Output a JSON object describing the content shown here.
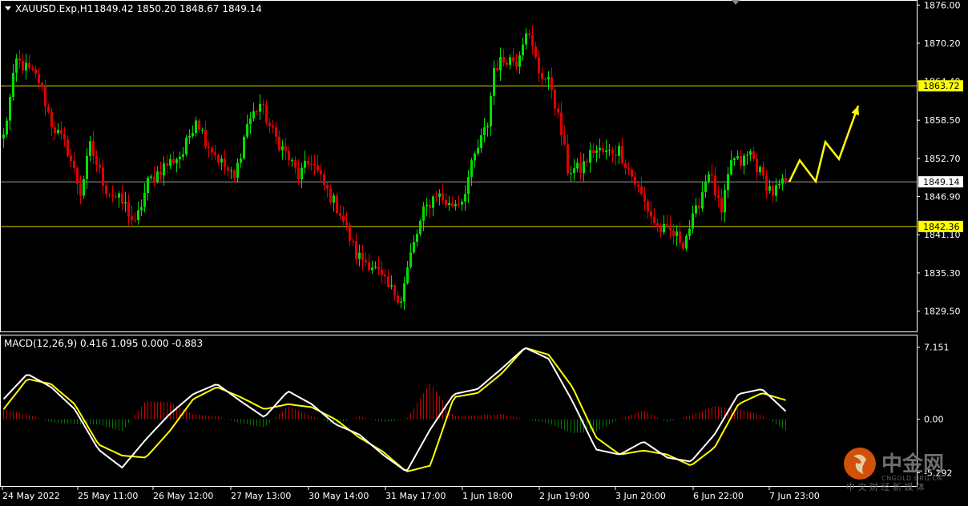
{
  "header": {
    "symbol_line": "XAUUSD.Exp,H1",
    "ohlc": "1849.42 1850.20 1848.67 1849.14",
    "macd_line": "MACD(12,26,9) 0.416 1.095 0.000 -0.883"
  },
  "watermark": {
    "logo_text": "中金网",
    "url_text": "CNGOLD.ORG.CN",
    "subtitle": "中 文 财 经 新 媒 体"
  },
  "chart_data": {
    "type": "candlestick",
    "symbol": "XAUUSD.Exp",
    "timeframe": "H1",
    "price_axis": {
      "min": 1827.5,
      "max": 1876.4,
      "ticks": [
        "1876.00",
        "1870.20",
        "1864.40",
        "1858.50",
        "1852.70",
        "1846.90",
        "1841.10",
        "1835.30",
        "1829.50"
      ]
    },
    "levels": [
      {
        "label": "1863.72",
        "value": 1863.72,
        "color": "#d8d800",
        "badge_bg": "#ffff00"
      },
      {
        "label": "1849.14",
        "value": 1849.14,
        "color": "#9a9a9a",
        "badge_bg": "#ffffff"
      },
      {
        "label": "1842.36",
        "value": 1842.36,
        "color": "#d8d800",
        "badge_bg": "#ffff00"
      }
    ],
    "time_labels": [
      "24 May 2022",
      "25 May 11:00",
      "26 May 12:00",
      "27 May 13:00",
      "30 May 14:00",
      "31 May 17:00",
      "1 Jun 18:00",
      "2 Jun 19:00",
      "3 Jun 20:00",
      "6 Jun 22:00",
      "7 Jun 23:00"
    ],
    "close_path": [
      [
        0,
        1856.0
      ],
      [
        4,
        1867.5
      ],
      [
        8,
        1866.0
      ],
      [
        11,
        1864.5
      ],
      [
        15,
        1858.0
      ],
      [
        20,
        1854.0
      ],
      [
        24,
        1847.5
      ],
      [
        27,
        1854.5
      ],
      [
        32,
        1848.0
      ],
      [
        38,
        1845.5
      ],
      [
        41,
        1842.5
      ],
      [
        45,
        1849.0
      ],
      [
        50,
        1851.5
      ],
      [
        56,
        1853.5
      ],
      [
        60,
        1859.0
      ],
      [
        63,
        1855.5
      ],
      [
        68,
        1852.0
      ],
      [
        72,
        1849.5
      ],
      [
        76,
        1858.0
      ],
      [
        80,
        1861.0
      ],
      [
        84,
        1856.5
      ],
      [
        88,
        1853.5
      ],
      [
        92,
        1850.0
      ],
      [
        96,
        1852.5
      ],
      [
        100,
        1848.5
      ],
      [
        105,
        1844.5
      ],
      [
        110,
        1838.0
      ],
      [
        115,
        1836.5
      ],
      [
        120,
        1833.0
      ],
      [
        124,
        1831.5
      ],
      [
        127,
        1838.0
      ],
      [
        131,
        1844.5
      ],
      [
        135,
        1847.5
      ],
      [
        139,
        1845.5
      ],
      [
        143,
        1846.5
      ],
      [
        147,
        1853.0
      ],
      [
        151,
        1858.0
      ],
      [
        153,
        1866.5
      ],
      [
        157,
        1868.0
      ],
      [
        160,
        1867.5
      ],
      [
        163,
        1872.5
      ],
      [
        167,
        1866.0
      ],
      [
        171,
        1863.5
      ],
      [
        174,
        1856.5
      ],
      [
        176,
        1851.0
      ],
      [
        180,
        1851.0
      ],
      [
        184,
        1854.0
      ],
      [
        188,
        1853.5
      ],
      [
        192,
        1854.0
      ],
      [
        196,
        1850.0
      ],
      [
        200,
        1846.0
      ],
      [
        204,
        1842.0
      ],
      [
        208,
        1841.5
      ],
      [
        212,
        1840.0
      ],
      [
        216,
        1844.5
      ],
      [
        220,
        1851.0
      ],
      [
        224,
        1844.0
      ],
      [
        227,
        1852.5
      ],
      [
        230,
        1852.0
      ],
      [
        233,
        1853.5
      ],
      [
        237,
        1849.5
      ],
      [
        240,
        1847.5
      ],
      [
        244,
        1849.14
      ]
    ],
    "projection": [
      1849.14,
      1852.4,
      1849.2,
      1855.2,
      1852.6,
      1860.7
    ],
    "macd": {
      "label": "MACD(12,26,9)",
      "values": [
        "0.416",
        "1.095",
        "0.000",
        "-0.883"
      ],
      "ticks": [
        "7.151",
        "0.00",
        "-5.292"
      ],
      "range": [
        -6.3,
        7.6
      ],
      "main_line": [
        2.0,
        4.5,
        3.2,
        1.0,
        -3.0,
        -4.8,
        -2.0,
        0.5,
        2.5,
        3.5,
        1.8,
        0.2,
        2.8,
        1.5,
        -0.5,
        -1.5,
        -3.5,
        -5.2,
        -1.0,
        2.5,
        3.0,
        5.0,
        7.1,
        6.0,
        1.8,
        -3.0,
        -3.5,
        -2.2,
        -3.8,
        -4.2,
        -1.5,
        2.5,
        3.0,
        0.8
      ],
      "signal_line": [
        1.0,
        4.0,
        3.5,
        1.5,
        -2.5,
        -3.6,
        -3.8,
        -1.2,
        2.0,
        3.2,
        2.2,
        1.0,
        1.5,
        1.2,
        0.0,
        -1.8,
        -3.2,
        -5.2,
        -4.6,
        2.2,
        2.6,
        4.5,
        7.1,
        6.4,
        3.2,
        -1.8,
        -3.5,
        -3.1,
        -3.5,
        -4.6,
        -2.8,
        1.5,
        2.6,
        1.9
      ],
      "histogram": [
        1.0,
        0.5,
        -0.3,
        -0.5,
        -0.5,
        -1.2,
        1.8,
        1.7,
        0.5,
        0.3,
        -0.4,
        -0.8,
        1.3,
        0.3,
        -0.5,
        0.3,
        -0.3,
        0.0,
        3.6,
        0.3,
        0.4,
        0.5,
        0.0,
        -0.4,
        -1.4,
        -1.2,
        0.0,
        0.9,
        -0.3,
        0.4,
        1.3,
        1.0,
        0.4,
        -1.1
      ]
    },
    "colors": {
      "background": "#000000",
      "bull": "#00e000",
      "bear": "#e00000",
      "axis_text": "#ffffff",
      "macd_main": "#ffffff",
      "macd_signal": "#ffff00",
      "hist_pos": "#c80000",
      "hist_neg": "#007a00",
      "projection": "#ffff00"
    }
  }
}
